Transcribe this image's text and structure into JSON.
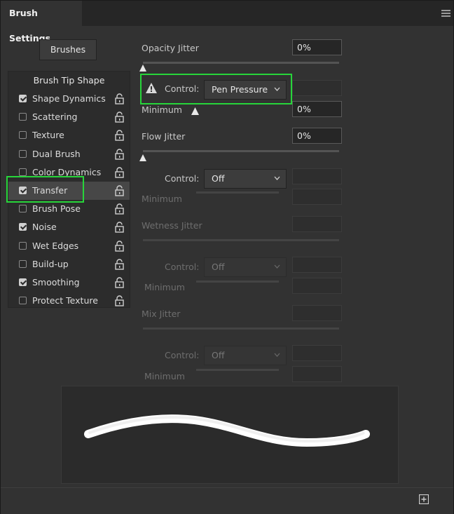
{
  "panel": {
    "tab_title": "Brush Settings"
  },
  "brushes_button": "Brushes",
  "left_list": {
    "header": "Brush Tip Shape",
    "items": [
      {
        "label": "Shape Dynamics",
        "checked": true
      },
      {
        "label": "Scattering",
        "checked": false
      },
      {
        "label": "Texture",
        "checked": false
      },
      {
        "label": "Dual Brush",
        "checked": false
      },
      {
        "label": "Color Dynamics",
        "checked": false
      },
      {
        "label": "Transfer",
        "checked": true,
        "selected": true
      },
      {
        "label": "Brush Pose",
        "checked": false
      },
      {
        "label": "Noise",
        "checked": true
      },
      {
        "label": "Wet Edges",
        "checked": false
      },
      {
        "label": "Build-up",
        "checked": false
      },
      {
        "label": "Smoothing",
        "checked": true
      },
      {
        "label": "Protect Texture",
        "checked": false
      }
    ]
  },
  "opacity": {
    "label": "Opacity Jitter",
    "value": "0%",
    "control_label": "Control:",
    "control_value": "Pen Pressure",
    "minimum_label": "Minimum",
    "minimum_value": "0%"
  },
  "flow": {
    "label": "Flow Jitter",
    "value": "0%",
    "control_label": "Control:",
    "control_value": "Off",
    "minimum_label": "Minimum"
  },
  "wetness": {
    "label": "Wetness Jitter",
    "control_label": "Control:",
    "control_value": "Off",
    "minimum_label": "Minimum"
  },
  "mix": {
    "label": "Mix Jitter",
    "control_label": "Control:",
    "control_value": "Off",
    "minimum_label": "Minimum"
  },
  "colors": {
    "highlight": "#27d53a",
    "panel_bg": "#323232",
    "stroke": "#ffffff"
  },
  "icons": {
    "lock": "lock-icon",
    "warning": "warning-icon",
    "new_preset": "new-preset-icon",
    "menu": "panel-menu-icon"
  }
}
